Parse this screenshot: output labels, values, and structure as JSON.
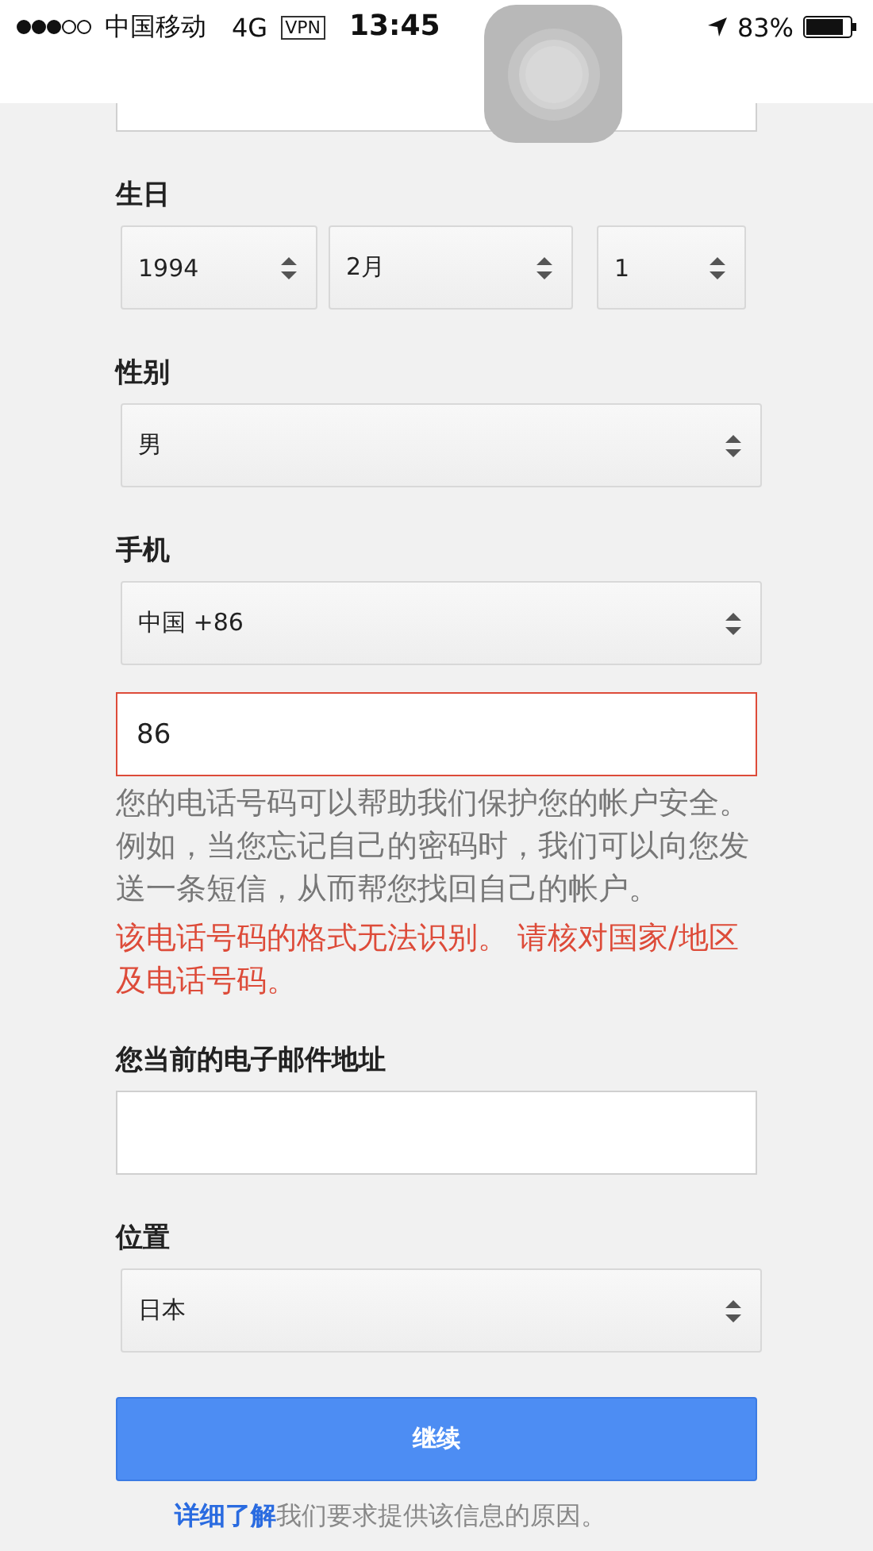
{
  "status_bar": {
    "carrier": "中国移动",
    "network": "4G",
    "vpn": "VPN",
    "time": "13:45",
    "battery": "83%"
  },
  "birthday": {
    "label": "生日",
    "selects": [
      {
        "value": "1994"
      },
      {
        "value": "2月"
      },
      {
        "value": "1"
      }
    ]
  },
  "gender": {
    "label": "性别",
    "value": "男"
  },
  "phone": {
    "label": "手机",
    "country": "中国  +86",
    "value": "86",
    "error": true,
    "help": "您的电话号码可以帮助我们保护您的帐户安全。例如，当您忘记自己的密码时，我们可以向您发送一条短信，从而帮您找回自己的帐户。",
    "error_message": "该电话号码的格式无法识别。 请核对国家/地区及电话号码。"
  },
  "email": {
    "label": "您当前的电子邮件地址"
  },
  "location": {
    "label": "位置",
    "value": "日本"
  },
  "continue_button": "继续",
  "footer": {
    "link": "详细了解",
    "text": "我们要求提供该信息的原因。"
  }
}
